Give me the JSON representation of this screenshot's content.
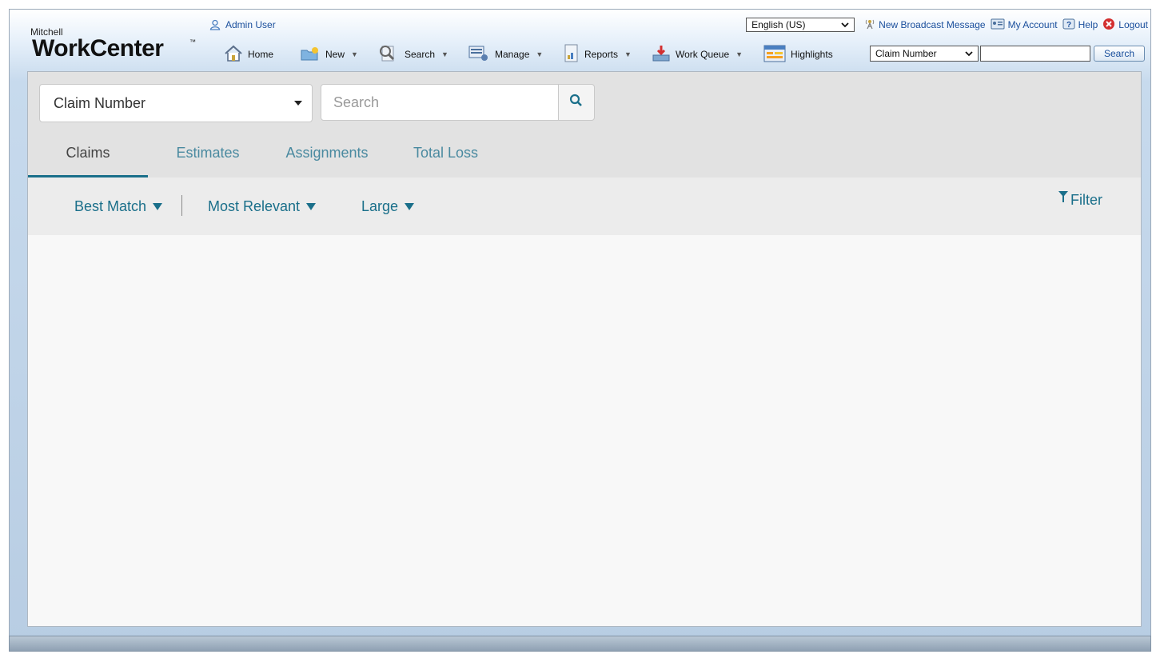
{
  "brand": {
    "small": "Mitchell",
    "big": "WorkCenter",
    "tm": "™"
  },
  "user": {
    "name": "Admin User"
  },
  "language": {
    "selected": "English (US)"
  },
  "toplinks": [
    {
      "label": "New Broadcast Message",
      "icon": "broadcast-icon"
    },
    {
      "label": "My Account",
      "icon": "account-card-icon"
    },
    {
      "label": "Help",
      "icon": "help-icon"
    },
    {
      "label": "Logout",
      "icon": "logout-icon"
    }
  ],
  "nav": [
    {
      "label": "Home",
      "icon": "home-icon"
    },
    {
      "label": "New",
      "icon": "folder-new-icon"
    },
    {
      "label": "Search",
      "icon": "magnifier-doc-icon"
    },
    {
      "label": "Manage",
      "icon": "manage-icon"
    },
    {
      "label": "Reports",
      "icon": "report-icon"
    },
    {
      "label": "Work Queue",
      "icon": "work-queue-icon"
    },
    {
      "label": "Highlights",
      "icon": "highlights-icon"
    }
  ],
  "quick_search": {
    "field": "Claim Number",
    "value": "",
    "button": "Search"
  },
  "search": {
    "field": "Claim Number",
    "placeholder": "Search"
  },
  "tabs": [
    {
      "label": "Claims",
      "active": true
    },
    {
      "label": "Estimates",
      "active": false
    },
    {
      "label": "Assignments",
      "active": false
    },
    {
      "label": "Total Loss",
      "active": false
    }
  ],
  "sort": {
    "match": "Best Match",
    "relevance": "Most Relevant",
    "size": "Large"
  },
  "filter": {
    "label": "Filter"
  },
  "colors": {
    "accent": "#1a6f8a",
    "link": "#1a4f9c",
    "logout": "#d32f2f"
  }
}
